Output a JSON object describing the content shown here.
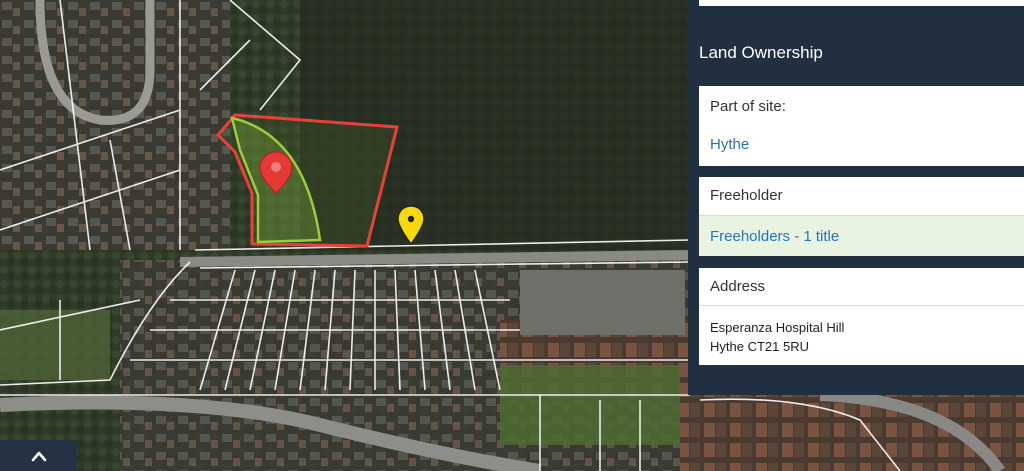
{
  "map": {
    "imagery": "satellite",
    "site_boundary_color": "#e8403a",
    "ownership_boundary_color": "#9ccc3a",
    "pins": [
      {
        "name": "red-location-pin-icon",
        "color": "#e53935"
      },
      {
        "name": "yellow-location-pin-icon",
        "color": "#f5d90a"
      }
    ]
  },
  "panel": {
    "title": "Land Ownership",
    "part_of_site": {
      "label": "Part of site:",
      "value": "Hythe"
    },
    "freeholder": {
      "label": "Freeholder",
      "link": "Freeholders - 1 title"
    },
    "address": {
      "label": "Address",
      "line1": "Esperanza Hospital Hill",
      "line2": "Hythe CT21 5RU"
    }
  },
  "scroll_button": {
    "icon": "chevron-up-icon"
  },
  "colors": {
    "panel_bg": "#203040",
    "link": "#2a73b3",
    "highlight_row": "#e8f4e1"
  }
}
